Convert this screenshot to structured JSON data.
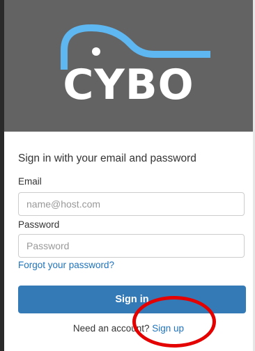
{
  "brand": {
    "logo_text": "CYBO",
    "accent_color": "#5fb7f1",
    "panel_color": "#636363"
  },
  "form": {
    "heading": "Sign in with your email and password",
    "email_label": "Email",
    "email_placeholder": "name@host.com",
    "password_label": "Password",
    "password_placeholder": "Password",
    "forgot_link": "Forgot your password?",
    "signin_button": "Sign in",
    "signup_prompt": "Need an account?",
    "signup_link": "Sign up",
    "button_color": "#337ab7",
    "link_color": "#1e73be"
  },
  "annotation": {
    "color": "#e50000",
    "shape": "ellipse"
  }
}
